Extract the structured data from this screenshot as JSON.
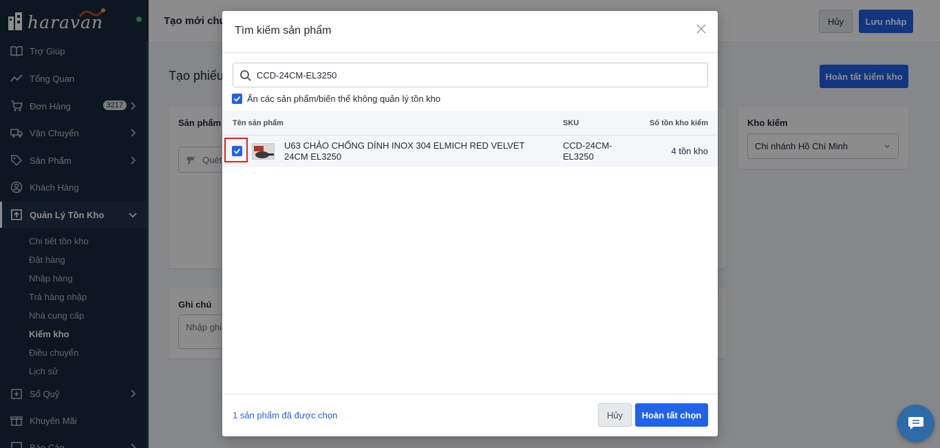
{
  "sidebar": {
    "logo_text": "haravan",
    "nav": [
      {
        "label": "Trợ Giúp",
        "icon": "book-icon"
      },
      {
        "label": "Tổng Quan",
        "icon": "chart-line-icon"
      },
      {
        "label": "Đơn Hàng",
        "icon": "cart-icon",
        "badge": "3217"
      },
      {
        "label": "Vận Chuyển",
        "icon": "truck-icon"
      },
      {
        "label": "Sản Phẩm",
        "icon": "tag-icon"
      },
      {
        "label": "Khách Hàng",
        "icon": "user-icon"
      },
      {
        "label": "Quản Lý Tồn Kho",
        "icon": "inventory-icon"
      },
      {
        "label": "Sổ Quỹ",
        "icon": "ledger-icon"
      },
      {
        "label": "Khuyến Mãi",
        "icon": "gift-icon"
      },
      {
        "label": "Báo Cáo",
        "icon": "report-icon"
      }
    ],
    "sub": [
      "Chi tiết tồn kho",
      "Đặt hàng",
      "Nhập hàng",
      "Trả hàng nhập",
      "Nhà cung cấp",
      "Kiểm kho",
      "Điều chuyển",
      "Lịch sử"
    ]
  },
  "topbar": {
    "title": "Tạo mới chư",
    "cancel_label": "Hủy",
    "save_draft_label": "Lưu nháp"
  },
  "page": {
    "title": "Tạo phiếu",
    "complete_check_label": "Hoàn tất kiểm kho",
    "product_card_title": "Sản phẩm",
    "scan_placeholder": "Quét",
    "note_card_title": "Ghi chú",
    "note_placeholder": "Nhập ghi",
    "warehouse_card_title": "Kho kiểm",
    "warehouse_value": "Chi nhánh Hồ Chí Minh"
  },
  "modal": {
    "title": "Tìm kiếm sản phẩm",
    "search_value": "CCD-24CM-EL3250",
    "hide_label": "Ẩn các sản phẩm/biến thể không quản lý tồn kho",
    "columns": {
      "name": "Tên sản phẩm",
      "sku": "SKU",
      "stock": "Số tồn kho kiểm"
    },
    "rows": [
      {
        "name": "U63 CHẢO CHỐNG DÍNH INOX 304 ELMICH RED VELVET 24CM EL3250",
        "sku": "CCD-24CM-EL3250",
        "stock": "4 tồn kho",
        "checked": true
      }
    ],
    "selected_count": "1 sản phẩm đã được chọn",
    "cancel_label": "Hủy",
    "done_label": "Hoàn tất chọn"
  }
}
